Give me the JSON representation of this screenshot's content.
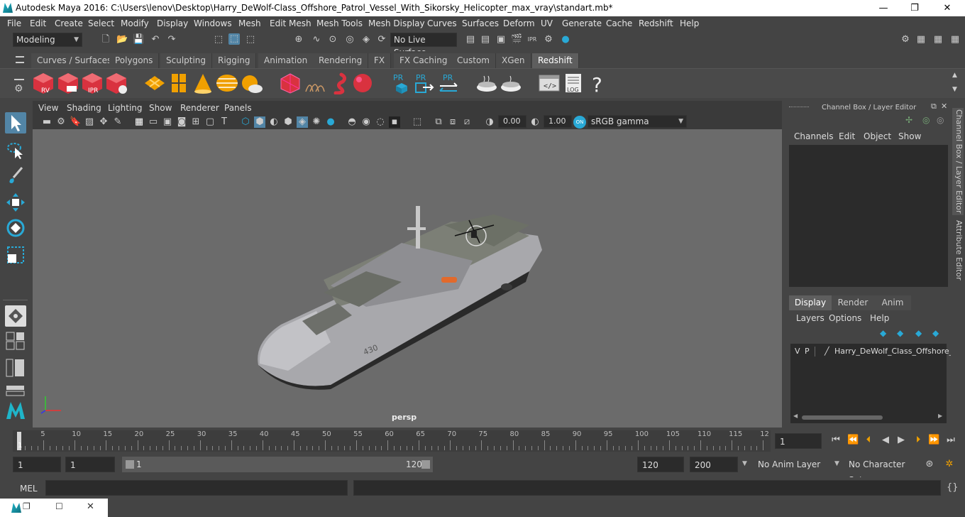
{
  "window": {
    "title": "Autodesk Maya 2016: C:\\Users\\lenov\\Desktop\\Harry_DeWolf-Class_Offshore_Patrol_Vessel_With_Sikorsky_Helicopter_max_vray\\standart.mb*",
    "minimize": "—",
    "maximize": "❐",
    "close": "✕"
  },
  "menu": [
    "File",
    "Edit",
    "Create",
    "Select",
    "Modify",
    "Display",
    "Windows",
    "Mesh",
    "Edit Mesh",
    "Mesh Tools",
    "Mesh Display",
    "Curves",
    "Surfaces",
    "Deform",
    "UV",
    "Generate",
    "Cache",
    "Redshift",
    "Help"
  ],
  "status": {
    "mode": "Modeling",
    "live_surface": "No Live Surface"
  },
  "shelf_tabs": [
    "Curves / Surfaces",
    "Polygons",
    "Sculpting",
    "Rigging",
    "Animation",
    "Rendering",
    "FX",
    "FX Caching",
    "Custom",
    "XGen",
    "Redshift"
  ],
  "shelf_active": "Redshift",
  "shelf_icons": {
    "rv": "RV",
    "ipr": "IPR",
    "pr1": "PR",
    "pr2": "PR",
    "pr3": "PR",
    "log": "LOG",
    "help": "?"
  },
  "panel_menu": [
    "View",
    "Shading",
    "Lighting",
    "Show",
    "Renderer",
    "Panels"
  ],
  "viewport": {
    "exposure": "0.00",
    "gamma": "1.00",
    "color_space": "sRGB gamma",
    "camera_label": "persp",
    "hull_number": "430"
  },
  "channel_box": {
    "title": "Channel Box / Layer Editor",
    "menu": [
      "Channels",
      "Edit",
      "Object",
      "Show"
    ]
  },
  "layer_editor": {
    "tabs": [
      "Display",
      "Render",
      "Anim"
    ],
    "active_tab": "Display",
    "menu": [
      "Layers",
      "Options",
      "Help"
    ],
    "layer": {
      "v": "V",
      "p": "P",
      "name": "Harry_DeWolf_Class_Offshore_"
    }
  },
  "side_tabs": {
    "channel_box": "Channel Box / Layer Editor",
    "attribute_editor": "Attribute Editor"
  },
  "timeline": {
    "ticks": [
      "5",
      "10",
      "15",
      "20",
      "25",
      "30",
      "35",
      "40",
      "45",
      "50",
      "55",
      "60",
      "65",
      "70",
      "75",
      "80",
      "85",
      "90",
      "95",
      "100",
      "105",
      "110",
      "115",
      "12"
    ],
    "start_marker": "1",
    "current_frame": "1"
  },
  "range": {
    "start": "1",
    "playback_start": "1",
    "slider_start": "1",
    "slider_end": "120",
    "playback_end": "120",
    "end": "200",
    "anim_layer": "No Anim Layer",
    "character_set": "No Character Set"
  },
  "command": {
    "label": "MEL"
  },
  "colors": {
    "accent": "#5285a6",
    "redshift_red": "#d9323f",
    "highlight_orange": "#f0a000"
  }
}
